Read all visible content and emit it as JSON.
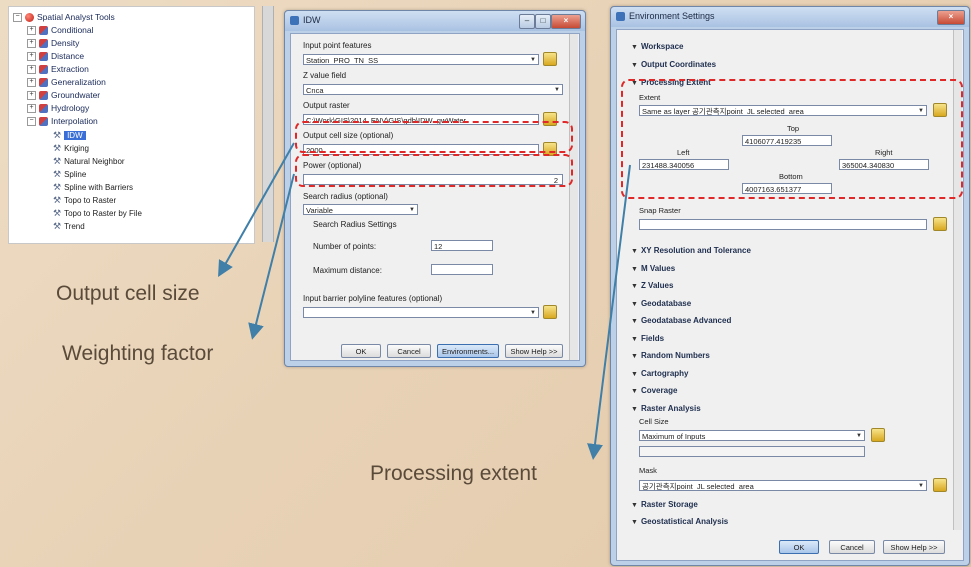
{
  "tree": {
    "root": "Spatial Analyst Tools",
    "toolsets": [
      "Conditional",
      "Density",
      "Distance",
      "Extraction",
      "Generalization",
      "Groundwater",
      "Hydrology",
      "Interpolation"
    ],
    "tools": [
      "IDW",
      "Kriging",
      "Natural Neighbor",
      "Spline",
      "Spline with Barriers",
      "Topo to Raster",
      "Topo to Raster by File",
      "Trend"
    ],
    "selected_tool": "IDW"
  },
  "idw": {
    "title": "IDW",
    "input_label": "Input point features",
    "input_value": "Station_PRO_TN_SS",
    "zfield_label": "Z value field",
    "zfield_value": "Cnca",
    "output_label": "Output raster",
    "output_value": "C:\\Work\\GIS\\2014_ENV\\GIS\\gdb\\IDW_gwWater",
    "cellsize_label": "Output cell size (optional)",
    "cellsize_value": "2000",
    "power_label": "Power (optional)",
    "power_value": "2",
    "search_label": "Search radius (optional)",
    "search_value": "Variable",
    "search_settings": "Search Radius Settings",
    "npoints_label": "Number of points:",
    "npoints_value": "12",
    "maxdist_label": "Maximum distance:",
    "maxdist_value": "",
    "barrier_label": "Input barrier polyline features (optional)",
    "buttons": {
      "ok": "OK",
      "cancel": "Cancel",
      "env": "Environments...",
      "help": "Show Help >>"
    }
  },
  "env": {
    "title": "Environment Settings",
    "sections_top": [
      "Workspace",
      "Output Coordinates",
      "Processing Extent"
    ],
    "extent_label": "Extent",
    "extent_value": "Same as layer 공기관측지point_JL selected_area",
    "top_label": "Top",
    "top_value": "4106077.419235",
    "left_label": "Left",
    "left_value": "231488.340056",
    "right_label": "Right",
    "right_value": "365004.340830",
    "bottom_label": "Bottom",
    "bottom_value": "4007163.651377",
    "snap_label": "Snap Raster",
    "sections_mid": [
      "XY Resolution and Tolerance",
      "M Values",
      "Z Values",
      "Geodatabase",
      "Geodatabase Advanced",
      "Fields",
      "Random Numbers",
      "Cartography",
      "Coverage",
      "Raster Analysis"
    ],
    "cellsize_label": "Cell Size",
    "cellsize_value": "Maximum of Inputs",
    "mask_label": "Mask",
    "mask_value": "공기관측지point_JL selected_area",
    "sections_bottom": [
      "Raster Storage",
      "Geostatistical Analysis"
    ],
    "buttons": {
      "ok": "OK",
      "cancel": "Cancel",
      "help": "Show Help >>"
    }
  },
  "annotations": {
    "cell_size": "Output cell size",
    "weighting": "Weighting factor",
    "extent": "Processing extent"
  },
  "colors": {
    "highlight": "#e02828",
    "arrow": "#3f7fa8",
    "annotation": "#5a4a3a"
  }
}
